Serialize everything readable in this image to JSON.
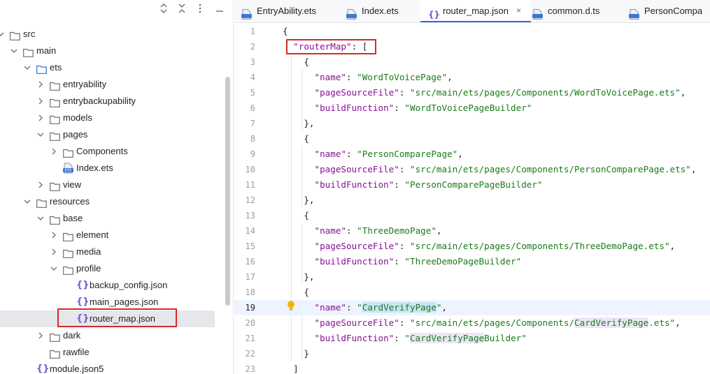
{
  "tree": {
    "items": [
      {
        "label": "src",
        "depth": 0,
        "kind": "folder",
        "expanded": true
      },
      {
        "label": "main",
        "depth": 1,
        "kind": "folder",
        "expanded": true
      },
      {
        "label": "ets",
        "depth": 2,
        "kind": "folder-blue",
        "expanded": true
      },
      {
        "label": "entryability",
        "depth": 3,
        "kind": "folder",
        "expanded": false
      },
      {
        "label": "entrybackupability",
        "depth": 3,
        "kind": "folder",
        "expanded": false
      },
      {
        "label": "models",
        "depth": 3,
        "kind": "folder",
        "expanded": false
      },
      {
        "label": "pages",
        "depth": 3,
        "kind": "folder",
        "expanded": true
      },
      {
        "label": "Components",
        "depth": 4,
        "kind": "folder",
        "expanded": false
      },
      {
        "label": "Index.ets",
        "depth": 4,
        "kind": "ets",
        "expanded": null
      },
      {
        "label": "view",
        "depth": 3,
        "kind": "folder",
        "expanded": false
      },
      {
        "label": "resources",
        "depth": 2,
        "kind": "folder",
        "expanded": true
      },
      {
        "label": "base",
        "depth": 3,
        "kind": "folder",
        "expanded": true
      },
      {
        "label": "element",
        "depth": 4,
        "kind": "folder",
        "expanded": false
      },
      {
        "label": "media",
        "depth": 4,
        "kind": "folder",
        "expanded": false
      },
      {
        "label": "profile",
        "depth": 4,
        "kind": "folder",
        "expanded": true
      },
      {
        "label": "backup_config.json",
        "depth": 5,
        "kind": "json",
        "expanded": null
      },
      {
        "label": "main_pages.json",
        "depth": 5,
        "kind": "json",
        "expanded": null
      },
      {
        "label": "router_map.json",
        "depth": 5,
        "kind": "json",
        "expanded": null,
        "selected": true
      },
      {
        "label": "dark",
        "depth": 3,
        "kind": "folder",
        "expanded": false
      },
      {
        "label": "rawfile",
        "depth": 3,
        "kind": "folder",
        "expanded": null
      },
      {
        "label": "module.json5",
        "depth": 2,
        "kind": "json",
        "expanded": null
      }
    ]
  },
  "tabs": [
    {
      "label": "EntryAbility.ets",
      "icon": "ets-file-icon",
      "badge": "ETS"
    },
    {
      "label": "Index.ets",
      "icon": "ets-file-icon",
      "badge": "ETS"
    },
    {
      "label": "router_map.json",
      "icon": "json-file-icon",
      "active": true,
      "close": "×"
    },
    {
      "label": "common.d.ts",
      "icon": "ts-file-icon",
      "badge": "TS"
    },
    {
      "label": "PersonCompa",
      "icon": "ets-file-icon",
      "badge": "ETS"
    }
  ],
  "editor": {
    "current_line": 19,
    "lines": [
      {
        "n": "1",
        "tokens": [
          [
            "p",
            "{"
          ]
        ]
      },
      {
        "n": "2",
        "tokens": [
          [
            "p",
            "  "
          ],
          [
            "k",
            "\"routerMap\""
          ],
          [
            "p",
            ": ["
          ]
        ]
      },
      {
        "n": "3",
        "tokens": [
          [
            "p",
            "    {"
          ]
        ]
      },
      {
        "n": "4",
        "tokens": [
          [
            "p",
            "      "
          ],
          [
            "k",
            "\"name\""
          ],
          [
            "p",
            ": "
          ],
          [
            "s",
            "\"WordToVoicePage\""
          ],
          [
            "p",
            ","
          ]
        ]
      },
      {
        "n": "5",
        "tokens": [
          [
            "p",
            "      "
          ],
          [
            "k",
            "\"pageSourceFile\""
          ],
          [
            "p",
            ": "
          ],
          [
            "s",
            "\"src/main/ets/pages/Components/WordToVoicePage.ets\""
          ],
          [
            "p",
            ","
          ]
        ]
      },
      {
        "n": "6",
        "tokens": [
          [
            "p",
            "      "
          ],
          [
            "k",
            "\"buildFunction\""
          ],
          [
            "p",
            ": "
          ],
          [
            "s",
            "\"WordToVoicePageBuilder\""
          ]
        ]
      },
      {
        "n": "7",
        "tokens": [
          [
            "p",
            "    },"
          ]
        ]
      },
      {
        "n": "8",
        "tokens": [
          [
            "p",
            "    {"
          ]
        ]
      },
      {
        "n": "9",
        "tokens": [
          [
            "p",
            "      "
          ],
          [
            "k",
            "\"name\""
          ],
          [
            "p",
            ": "
          ],
          [
            "s",
            "\"PersonComparePage\""
          ],
          [
            "p",
            ","
          ]
        ]
      },
      {
        "n": "10",
        "tokens": [
          [
            "p",
            "      "
          ],
          [
            "k",
            "\"pageSourceFile\""
          ],
          [
            "p",
            ": "
          ],
          [
            "s",
            "\"src/main/ets/pages/Components/PersonComparePage.ets\""
          ],
          [
            "p",
            ","
          ]
        ]
      },
      {
        "n": "11",
        "tokens": [
          [
            "p",
            "      "
          ],
          [
            "k",
            "\"buildFunction\""
          ],
          [
            "p",
            ": "
          ],
          [
            "s",
            "\"PersonComparePageBuilder\""
          ]
        ]
      },
      {
        "n": "12",
        "tokens": [
          [
            "p",
            "    },"
          ]
        ]
      },
      {
        "n": "13",
        "tokens": [
          [
            "p",
            "    {"
          ]
        ]
      },
      {
        "n": "14",
        "tokens": [
          [
            "p",
            "      "
          ],
          [
            "k",
            "\"name\""
          ],
          [
            "p",
            ": "
          ],
          [
            "s",
            "\"ThreeDemoPage\""
          ],
          [
            "p",
            ","
          ]
        ]
      },
      {
        "n": "15",
        "tokens": [
          [
            "p",
            "      "
          ],
          [
            "k",
            "\"pageSourceFile\""
          ],
          [
            "p",
            ": "
          ],
          [
            "s",
            "\"src/main/ets/pages/Components/ThreeDemoPage.ets\""
          ],
          [
            "p",
            ","
          ]
        ]
      },
      {
        "n": "16",
        "tokens": [
          [
            "p",
            "      "
          ],
          [
            "k",
            "\"buildFunction\""
          ],
          [
            "p",
            ": "
          ],
          [
            "s",
            "\"ThreeDemoPageBuilder\""
          ]
        ]
      },
      {
        "n": "17",
        "tokens": [
          [
            "p",
            "    },"
          ]
        ]
      },
      {
        "n": "18",
        "tokens": [
          [
            "p",
            "    {"
          ]
        ]
      },
      {
        "n": "19",
        "tokens": [
          [
            "p",
            "      "
          ],
          [
            "k",
            "\"name\""
          ],
          [
            "p",
            ": "
          ],
          [
            "s",
            "\""
          ],
          [
            "s hl-var",
            "CardVerifyPage"
          ],
          [
            "s",
            "\""
          ],
          [
            "p",
            ","
          ]
        ]
      },
      {
        "n": "20",
        "tokens": [
          [
            "p",
            "      "
          ],
          [
            "k",
            "\"pageSourceFile\""
          ],
          [
            "p",
            ": "
          ],
          [
            "s",
            "\"src/main/ets/pages/Components/"
          ],
          [
            "s hl-soft",
            "CardVerifyPage"
          ],
          [
            "s",
            ".ets\""
          ],
          [
            "p",
            ","
          ]
        ]
      },
      {
        "n": "21",
        "tokens": [
          [
            "p",
            "      "
          ],
          [
            "k",
            "\"buildFunction\""
          ],
          [
            "p",
            ": "
          ],
          [
            "s",
            "\""
          ],
          [
            "s hl-soft",
            "CardVerifyPage"
          ],
          [
            "s",
            "Builder\""
          ]
        ]
      },
      {
        "n": "22",
        "tokens": [
          [
            "p",
            "    }"
          ]
        ]
      },
      {
        "n": "23",
        "tokens": [
          [
            "p",
            "  ]"
          ]
        ]
      }
    ]
  },
  "colors": {
    "highlight_box": "#d42a2a",
    "tab_underline": "#2f6ddf",
    "json_key": "#871094",
    "json_string": "#1a7a1a"
  }
}
